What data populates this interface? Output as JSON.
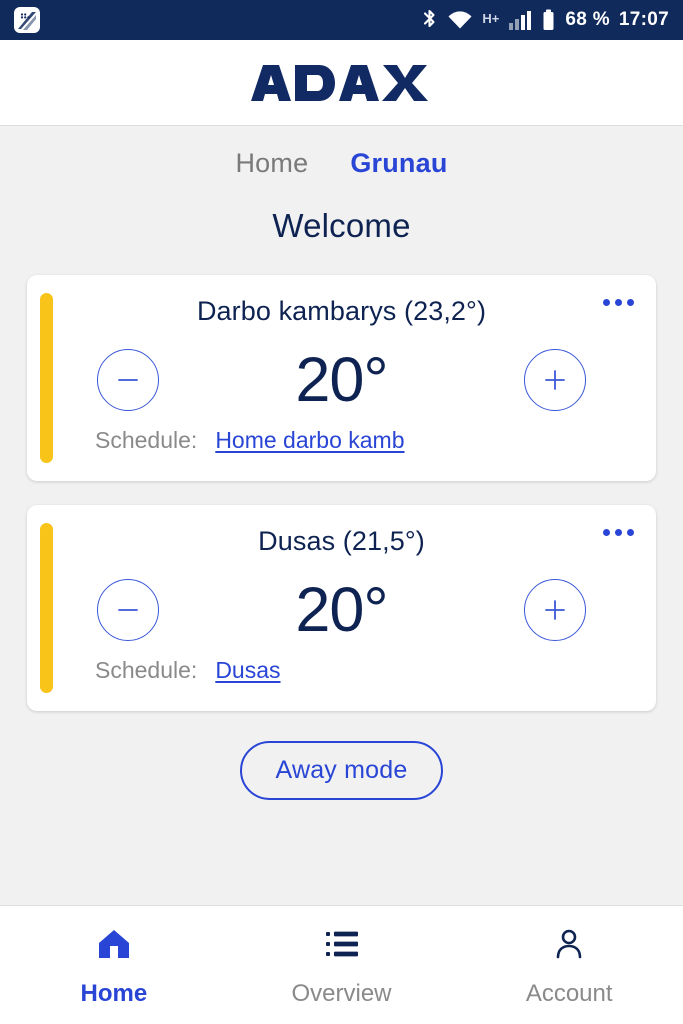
{
  "statusbar": {
    "app_icon": "app-badge-icon",
    "bluetooth_icon": "bluetooth-icon",
    "wifi_icon": "wifi-icon",
    "network_type": "H+",
    "signal_icon": "signal-bars-icon",
    "battery_icon": "battery-icon",
    "battery_text": "68 %",
    "clock": "17:07"
  },
  "header": {
    "brand": "ADAX",
    "brand_color": "#122A63"
  },
  "tabs": [
    {
      "label": "Home",
      "active": false
    },
    {
      "label": "Grunau",
      "active": true
    }
  ],
  "page_title": "Welcome",
  "rooms": [
    {
      "title": "Darbo kambarys (23,2°)",
      "name": "Darbo kambarys",
      "current_temp": "23,2°",
      "target_temp": "20°",
      "accent_color": "#F8C41A",
      "menu_icon": "more-options-icon",
      "decrease_icon": "minus-icon",
      "increase_icon": "plus-icon",
      "schedule_label": "Schedule:",
      "schedule_value": "Home darbo kamb"
    },
    {
      "title": "Dusas (21,5°)",
      "name": "Dusas",
      "current_temp": "21,5°",
      "target_temp": "20°",
      "accent_color": "#F8C41A",
      "menu_icon": "more-options-icon",
      "decrease_icon": "minus-icon",
      "increase_icon": "plus-icon",
      "schedule_label": "Schedule:",
      "schedule_value": "Dusas"
    }
  ],
  "away_button": "Away mode",
  "bottom_nav": [
    {
      "label": "Home",
      "icon": "home-icon",
      "active": true
    },
    {
      "label": "Overview",
      "icon": "list-icon",
      "active": false
    },
    {
      "label": "Account",
      "icon": "person-icon",
      "active": false
    }
  ],
  "colors": {
    "accent_blue": "#2945D6",
    "navy": "#0E2352",
    "statusbar_bg": "#102A5C",
    "page_bg": "#F1F1F1",
    "yellow": "#F8C41A"
  }
}
